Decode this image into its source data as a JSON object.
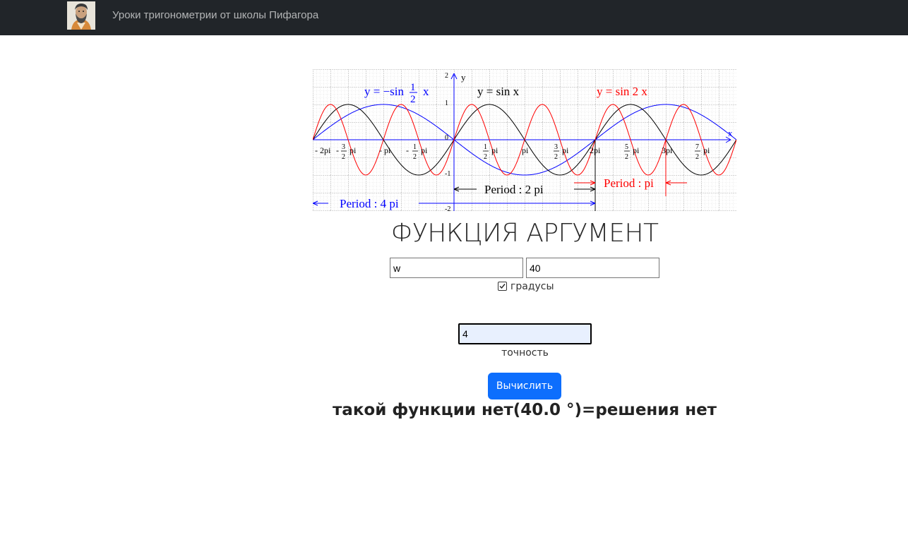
{
  "navbar": {
    "brand": "Уроки тригонометрии от школы Пифагора",
    "logo_icon": "pythagoras-avatar"
  },
  "graph": {
    "formulas": {
      "blue_prefix": "y = −sin",
      "blue_frac_num": "1",
      "blue_frac_den": "2",
      "blue_var": "x",
      "black": "y = sin x",
      "red": "y = sin 2 x"
    },
    "axis_x": "x",
    "axis_y": "y",
    "y_ticks": [
      "2",
      "1",
      "0",
      "-1",
      "-2"
    ],
    "x_ticks": {
      "neg_2pi": "- 2pi",
      "neg_3_2_sign": "-",
      "neg_3_2_num": "3",
      "neg_3_2_den": "2",
      "neg_3_2_pi": "pi",
      "neg_pi": "- pi",
      "neg_1_2_sign": "-",
      "neg_1_2_num": "1",
      "neg_1_2_den": "2",
      "neg_1_2_pi": "pi",
      "pos_1_2_num": "1",
      "pos_1_2_den": "2",
      "pos_1_2_pi": "pi",
      "pos_pi": "pi",
      "pos_3_2_num": "3",
      "pos_3_2_den": "2",
      "pos_3_2_pi": "pi",
      "pos_2pi": "2pi",
      "pos_5_2_num": "5",
      "pos_5_2_den": "2",
      "pos_5_2_pi": "pi",
      "pos_3pi": "3pi",
      "pos_7_2_num": "7",
      "pos_7_2_den": "2",
      "pos_7_2_pi": "pi"
    },
    "periods": {
      "black": "Period : 2 pi",
      "red": "Period : pi",
      "blue": "Period : 4 pi"
    },
    "colors": {
      "sin_x": "#000000",
      "sin_2x": "#ff0000",
      "neg_sin_half_x": "#0000ff",
      "grid": "#bdbdbd"
    }
  },
  "page_title": "ФУНКЦИЯ АРГУМЕНТ",
  "form": {
    "function_value": "w",
    "argument_value": "40",
    "degrees_label": "градусы",
    "degrees_checked": true,
    "precision_value": "4",
    "precision_label": "точность",
    "submit_label": "Вычислить"
  },
  "result": "такой функции нет(40.0 °)=решения нет"
}
